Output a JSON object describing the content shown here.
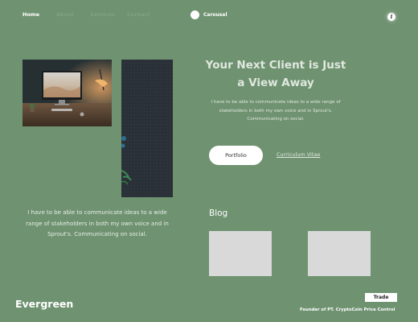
{
  "nav": {
    "home_label": "Home",
    "link2_label": "About",
    "link3_label": "Services",
    "link4_label": "Contact",
    "carousel_label": "Carousel",
    "info_icon": "info-icon",
    "info_glyph": "i"
  },
  "images": {
    "desk_photo": "desk-workspace-image",
    "tall_photo": "dark-wall-plant-image"
  },
  "hero": {
    "title": "Your Next Client is Just a View Away",
    "text": "I have to be able to communicate ideas to a wide range of stakeholders in both my own voice and in Sprout's. Communicating on social.",
    "portfolio_label": "Portfolio",
    "cv_label": "Curriculum Vitae"
  },
  "left": {
    "text": "I have to be able to communicate ideas to a wide range of stakeholders in both my own voice and in Sprout's. Communicating on social."
  },
  "blog": {
    "heading": "Blog"
  },
  "footer": {
    "brand": "Evergreen",
    "trade_label": "Trade",
    "founder": "Founder of PT. CryptoCoin Price Control"
  },
  "colors": {
    "background": "#6f9271",
    "faded_nav": "#7fa280",
    "card": "#d9d9d9"
  }
}
